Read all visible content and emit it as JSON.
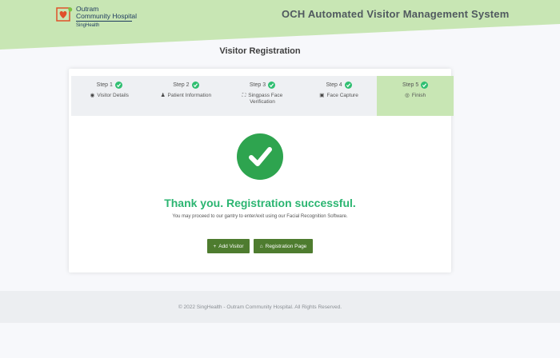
{
  "brand": {
    "logo_line1": "Outram",
    "logo_line2": "Community Hospital",
    "logo_sub": "SingHealth",
    "accent": "#c8e6b4"
  },
  "header": {
    "app_title": "OCH Automated Visitor Management System"
  },
  "page": {
    "title": "Visitor Registration"
  },
  "steps": [
    {
      "label": "Step 1",
      "title": "Visitor Details",
      "icon": "user-circle-icon",
      "status": "done"
    },
    {
      "label": "Step 2",
      "title": "Patient Information",
      "icon": "user-icon",
      "status": "done"
    },
    {
      "label": "Step 3",
      "title": "Singpass Face Verification",
      "icon": "face-scan-icon",
      "status": "done"
    },
    {
      "label": "Step 4",
      "title": "Face Capture",
      "icon": "camera-icon",
      "status": "done"
    },
    {
      "label": "Step 5",
      "title": "Finish",
      "icon": "check-circle-icon",
      "status": "active"
    }
  ],
  "result": {
    "title": "Thank you. Registration successful.",
    "message": "You may proceed to our gantry to enter/exit using our Facial Recognition Software.",
    "success_color": "#2ea44f"
  },
  "actions": {
    "add_visitor": "Add Visitor",
    "registration_page": "Registration Page",
    "button_color": "#4e7c2f"
  },
  "footer": {
    "text": "© 2022 SingHealth - Outram Community Hospital. All Rights Reserved."
  }
}
